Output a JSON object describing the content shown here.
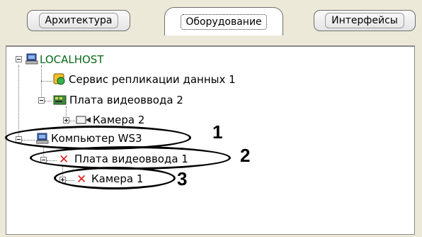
{
  "tabs": [
    {
      "label": "Архитектура",
      "active": false
    },
    {
      "label": "Оборудование",
      "active": true
    },
    {
      "label": "Интерфейсы",
      "active": false
    }
  ],
  "tree": {
    "localhost": "LOCALHOST",
    "replication": "Сервис репликации данных 1",
    "capture_board_2": "Плата видеоввода 2",
    "camera_2": "Камера 2",
    "computer_ws3": "Компьютер WS3",
    "capture_board_1": "Плата видеоввода 1",
    "camera_1": "Камера 1"
  },
  "callouts": [
    "1",
    "2",
    "3"
  ],
  "colors": {
    "localhost_text": "#0a6a1a",
    "error_mark": "#e0201c",
    "window_bg": "#ece9d8"
  },
  "icons": {
    "computer": "computer-icon",
    "replication": "database-service-icon",
    "board": "capture-board-icon",
    "camera": "camera-icon",
    "error": "red-x-icon"
  }
}
